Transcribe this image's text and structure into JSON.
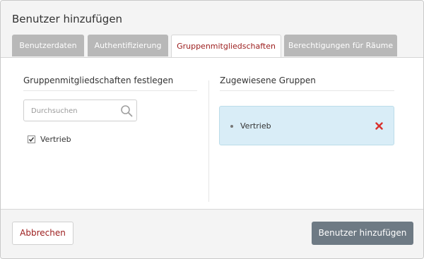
{
  "dialog": {
    "title": "Benutzer hinzufügen"
  },
  "tabs": [
    {
      "label": "Benutzerdaten",
      "active": false
    },
    {
      "label": "Authentifizierung",
      "active": false
    },
    {
      "label": "Gruppenmitgliedschaften",
      "active": true
    },
    {
      "label": "Berechtigungen für Räume",
      "active": false
    }
  ],
  "left_panel": {
    "title": "Gruppenmitgliedschaften festlegen",
    "search": {
      "placeholder": "Durchsuchen",
      "value": "",
      "icon": "search-icon"
    },
    "groups": [
      {
        "label": "Vertrieb",
        "checked": true
      }
    ]
  },
  "right_panel": {
    "title": "Zugewiesene Gruppen",
    "assigned": [
      {
        "label": "Vertrieb",
        "remove_icon": "remove-icon"
      }
    ]
  },
  "footer": {
    "cancel_label": "Abbrechen",
    "submit_label": "Benutzer hinzufügen"
  },
  "colors": {
    "accent_red": "#9b1b1b",
    "tab_inactive": "#b8b8b8",
    "assigned_bg": "#d9edf7",
    "primary_button": "#6e7a84",
    "remove_red": "#d9302c"
  }
}
